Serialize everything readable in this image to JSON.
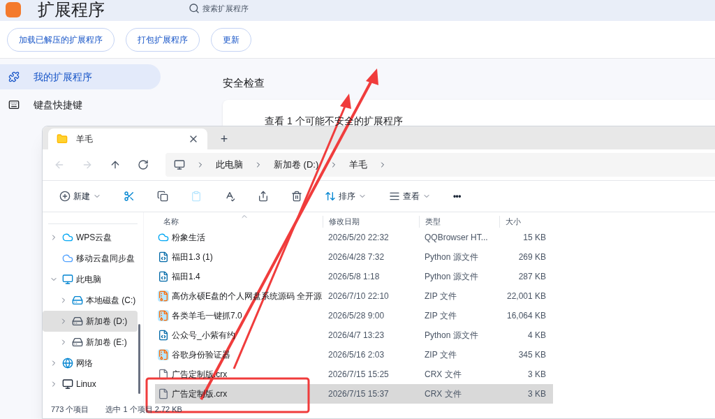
{
  "browser": {
    "title": "扩展程序",
    "search": {
      "placeholder": "搜索扩展程序"
    },
    "actions": [
      "加载已解压的扩展程序",
      "打包扩展程序",
      "更新"
    ],
    "sidebar": {
      "items": [
        {
          "label": "我的扩展程序",
          "kind": "extension",
          "selected": true
        },
        {
          "label": "键盘快捷键",
          "kind": "keyboard",
          "selected": false
        }
      ]
    },
    "section_title": "安全检查",
    "card_text": "查看 1 个可能不安全的扩展程序"
  },
  "explorer": {
    "tabs": [
      {
        "label": "羊毛",
        "selected": true
      }
    ],
    "new_tab": "+",
    "breadcrumb": [
      "此电脑",
      "新加卷 (D:)",
      "羊毛"
    ],
    "toolbar": [
      {
        "kind": "new",
        "label": "新建"
      },
      {
        "kind": "cut"
      },
      {
        "kind": "copy"
      },
      {
        "kind": "paste",
        "disabled": true
      },
      {
        "kind": "rename"
      },
      {
        "kind": "share"
      },
      {
        "kind": "delete"
      },
      {
        "kind": "sort",
        "label": "排序"
      },
      {
        "kind": "view",
        "label": "查看"
      },
      {
        "kind": "more",
        "label": "•••"
      }
    ],
    "nav": [
      {
        "label": "WPS云盘",
        "kind": "cloud",
        "expanded": false,
        "selected": false
      },
      {
        "label": "移动云盘同步盘",
        "kind": "sync",
        "selected": false
      },
      {
        "label": "此电脑",
        "kind": "pc",
        "expanded": true,
        "selected": false,
        "children": [
          {
            "label": "本地磁盘 (C:)",
            "kind": "sysdrive",
            "expanded": false,
            "selected": false
          },
          {
            "label": "新加卷 (D:)",
            "kind": "drive",
            "expanded": false,
            "selected": true
          },
          {
            "label": "新加卷 (E:)",
            "kind": "drive",
            "expanded": false,
            "selected": false
          }
        ]
      },
      {
        "label": "网络",
        "kind": "network",
        "expanded": false,
        "selected": false
      },
      {
        "label": "Linux",
        "kind": "linux",
        "expanded": false,
        "selected": false
      }
    ],
    "columns": [
      "名称",
      "修改日期",
      "类型",
      "大小"
    ],
    "rows": [
      {
        "kind": "app",
        "name": "粉象生活",
        "date": "2026/5/20 22:32",
        "type": "QQBrowser HT...",
        "size": "15 KB",
        "selected": false
      },
      {
        "kind": "python",
        "name": "福田1.3 (1)",
        "date": "2026/4/28 7:32",
        "type": "Python 源文件",
        "size": "269 KB",
        "selected": false
      },
      {
        "kind": "python",
        "name": "福田1.4",
        "date": "2026/5/8 1:18",
        "type": "Python 源文件",
        "size": "287 KB",
        "selected": false
      },
      {
        "kind": "zip",
        "name": "高仿永硕E盘的个人网盘系统源码 全开源",
        "date": "2026/7/10 22:10",
        "type": "ZIP 文件",
        "size": "22,001 KB",
        "selected": false
      },
      {
        "kind": "zip",
        "name": "各类羊毛一键抓7.0",
        "date": "2026/5/28 9:00",
        "type": "ZIP 文件",
        "size": "16,064 KB",
        "selected": false
      },
      {
        "kind": "python",
        "name": "公众号_小紫有约",
        "date": "2026/4/7 13:23",
        "type": "Python 源文件",
        "size": "4 KB",
        "selected": false
      },
      {
        "kind": "zip",
        "name": "谷歌身份验证器",
        "date": "2026/5/16 2:03",
        "type": "ZIP 文件",
        "size": "345 KB",
        "selected": false
      },
      {
        "kind": "file",
        "name": "广告定制版.crx",
        "date": "2026/7/15 15:25",
        "type": "CRX 文件",
        "size": "3 KB",
        "selected": false
      },
      {
        "kind": "file",
        "name": "广告定制版.crx",
        "date": "2026/7/15 15:37",
        "type": "CRX 文件",
        "size": "3 KB",
        "selected": true
      }
    ],
    "status": [
      "773 个项目",
      "选中 1 个项目 2.72 KB"
    ]
  }
}
